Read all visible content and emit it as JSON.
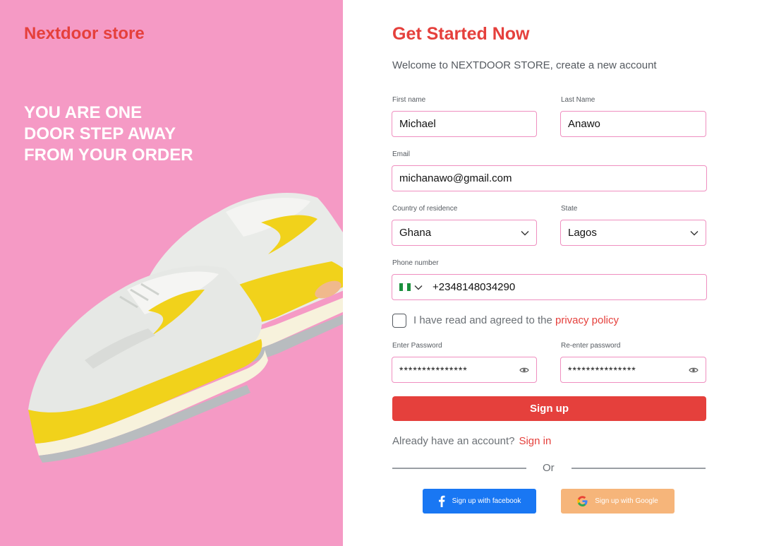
{
  "brand": {
    "name": "Nextdoor store",
    "color": "#e5403c",
    "panel_color": "#f59ac5"
  },
  "hero": {
    "tagline": [
      "YOU ARE ONE",
      "DOOR STEP AWAY",
      "FROM YOUR ORDER"
    ],
    "image": "yellow-white-sneakers"
  },
  "form": {
    "title": "Get Started Now",
    "subtitle": "Welcome to NEXTDOOR STORE, create a new account",
    "first_name": {
      "label": "First name",
      "value": "Michael"
    },
    "last_name": {
      "label": "Last Name",
      "value": "Anawo"
    },
    "email": {
      "label": "Email",
      "value": "michanawo@gmail.com"
    },
    "country": {
      "label": "Country of residence",
      "value": "Ghana",
      "icon": "chevron-down-icon"
    },
    "state": {
      "label": "State",
      "value": "Lagos",
      "icon": "chevron-down-icon"
    },
    "phone": {
      "label": "Phone number",
      "value": "+2348148034290",
      "flag": "nigeria-flag-icon"
    },
    "agreement": {
      "text": "I have read and agreed to the ",
      "link": "privacy policy",
      "checked": false
    },
    "password": {
      "label": "Enter Password",
      "value": "***************",
      "icon": "eye-icon"
    },
    "confirm_password": {
      "label": "Re-enter password",
      "value": "***************",
      "icon": "eye-icon"
    },
    "submit_label": "Sign up",
    "have_account_text": "Already have an account?",
    "signin_label": "Sign in",
    "divider_text": "Or",
    "facebook_label": "Sign up with facebook",
    "google_label": "Sign up with Google"
  },
  "colors": {
    "accent": "#e5403c",
    "field_border": "#ef8fc0",
    "facebook": "#1977f3",
    "google_button": "#f6b57a"
  }
}
